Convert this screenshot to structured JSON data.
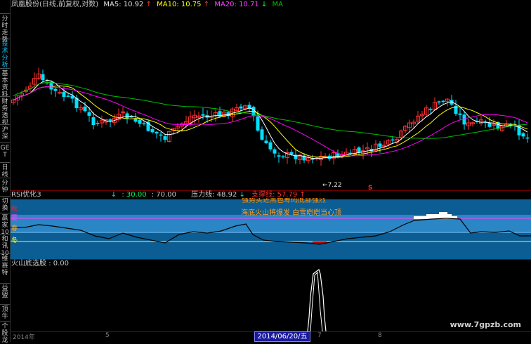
{
  "sidebar": {
    "items": [
      {
        "label": "分时走势",
        "active": false
      },
      {
        "label": "技术分析",
        "active": true
      },
      {
        "label": "基本资料",
        "active": false
      },
      {
        "label": "财务透视",
        "active": false
      },
      {
        "label": "沪深",
        "active": false
      },
      {
        "label": "GET",
        "active": false
      },
      {
        "label": "日线",
        "active": false
      },
      {
        "label": "分钟",
        "active": false
      },
      {
        "label": "切换",
        "active": false
      },
      {
        "label": "赢家10",
        "active": false
      },
      {
        "label": "和讯10",
        "active": false
      },
      {
        "label": "维赛特",
        "active": false
      },
      {
        "label": "益盟",
        "active": false
      },
      {
        "label": "顶牛",
        "active": false
      },
      {
        "label": "个股龙",
        "active": false
      }
    ]
  },
  "header": {
    "stock": "凤凰股份(日线,前复权,对数)",
    "ma5_label": "MA5:",
    "ma5_value": "10.92",
    "ma10_label": "MA10:",
    "ma10_value": "10.75",
    "ma20_label": "MA20:",
    "ma20_value": "10.71",
    "ma_tail": "MA"
  },
  "kline": {
    "low_marker": "7.22",
    "sell_marker": "S"
  },
  "rsi": {
    "title": "RSI优化3",
    "arrow": "↓",
    "range_a": ": 30.00",
    "range_b": ": 70.00",
    "resist_label": "压力线: 48.92",
    "support_label": "支撑线: 57.79",
    "overlay_text_1": "强势买进黑色筹码底部强烈",
    "overlay_text_2": "海底火山将爆发 白雪皑皑当心顶",
    "season_autumn": "秋",
    "season_summer": "夏",
    "season_spring": "春",
    "season_winter": "冬"
  },
  "volcano": {
    "title": "火山底选股",
    "value": ": 0.00"
  },
  "axis": {
    "year": "2014年",
    "month_5": "5",
    "month_7": "7",
    "month_8": "8",
    "date_cursor": "2014/06/20/五"
  },
  "watermark": "www.7gpzb.com",
  "colors": {
    "bg": "#000000",
    "rise": "#ff3030",
    "fall": "#00e0ff",
    "ma5": "#ffffff",
    "ma10": "#ffff00",
    "ma20": "#ff00ff",
    "ma60": "#00c000",
    "rsi_band_dark": "#1c78b8",
    "rsi_band_light": "#0a5a90"
  }
}
